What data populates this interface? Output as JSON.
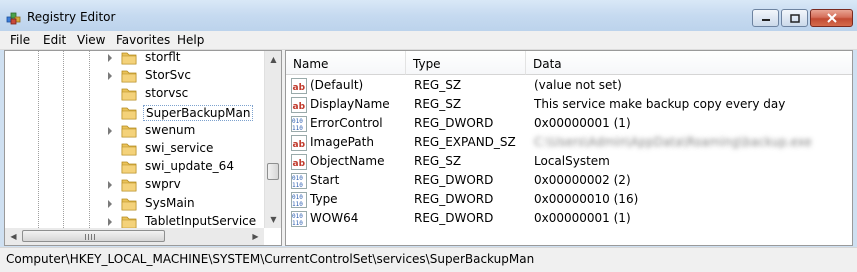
{
  "window": {
    "title": "Registry Editor"
  },
  "menu": [
    "File",
    "Edit",
    "View",
    "Favorites",
    "Help"
  ],
  "tree": {
    "items": [
      {
        "label": "storflt",
        "expandable": true
      },
      {
        "label": "StorSvc",
        "expandable": true
      },
      {
        "label": "storvsc",
        "expandable": false
      },
      {
        "label": "SuperBackupMan",
        "expandable": false,
        "selected": true
      },
      {
        "label": "swenum",
        "expandable": true
      },
      {
        "label": "swi_service",
        "expandable": false
      },
      {
        "label": "swi_update_64",
        "expandable": false
      },
      {
        "label": "swprv",
        "expandable": true
      },
      {
        "label": "SysMain",
        "expandable": true
      },
      {
        "label": "TabletInputService",
        "expandable": true
      }
    ]
  },
  "columns": {
    "name": "Name",
    "type": "Type",
    "data": "Data"
  },
  "values": [
    {
      "name": "(Default)",
      "type": "REG_SZ",
      "data": "(value not set)",
      "icon": "string-value-icon"
    },
    {
      "name": "DisplayName",
      "type": "REG_SZ",
      "data": "This service make backup copy every day",
      "icon": "string-value-icon"
    },
    {
      "name": "ErrorControl",
      "type": "REG_DWORD",
      "data": "0x00000001 (1)",
      "icon": "binary-value-icon"
    },
    {
      "name": "ImagePath",
      "type": "REG_EXPAND_SZ",
      "data": "C:\\Users\\Admin\\AppData\\Roaming\\backup.exe",
      "icon": "string-value-icon",
      "redacted": true
    },
    {
      "name": "ObjectName",
      "type": "REG_SZ",
      "data": "LocalSystem",
      "icon": "string-value-icon"
    },
    {
      "name": "Start",
      "type": "REG_DWORD",
      "data": "0x00000002 (2)",
      "icon": "binary-value-icon"
    },
    {
      "name": "Type",
      "type": "REG_DWORD",
      "data": "0x00000010 (16)",
      "icon": "binary-value-icon"
    },
    {
      "name": "WOW64",
      "type": "REG_DWORD",
      "data": "0x00000001 (1)",
      "icon": "binary-value-icon"
    }
  ],
  "status": {
    "path": "Computer\\HKEY_LOCAL_MACHINE\\SYSTEM\\CurrentControlSet\\services\\SuperBackupMan"
  },
  "colors": {
    "folder": "#e9c25a",
    "string_icon_red": "#c0392b",
    "binary_icon_blue": "#2a5db0",
    "titlebar": "#c6daf0"
  }
}
